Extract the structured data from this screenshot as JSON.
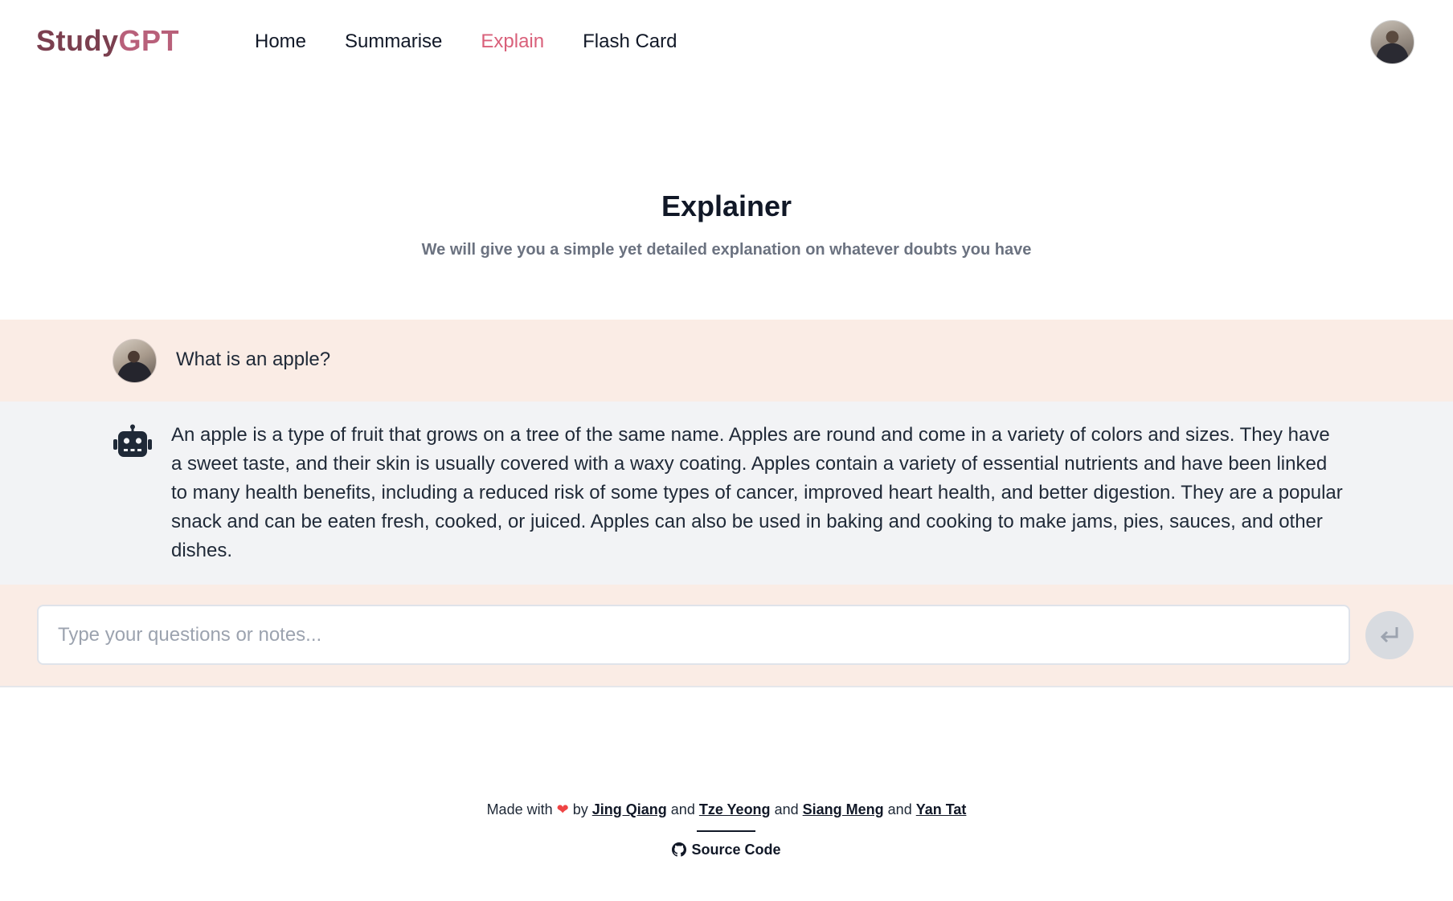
{
  "header": {
    "brand_part1": "Study",
    "brand_part2": "GPT",
    "nav": [
      {
        "label": "Home"
      },
      {
        "label": "Summarise"
      },
      {
        "label": "Explain"
      },
      {
        "label": "Flash Card"
      }
    ],
    "active_nav": "Explain"
  },
  "hero": {
    "title": "Explainer",
    "subtitle": "We will give you a simple yet detailed explanation on whatever doubts you have"
  },
  "chat": {
    "question": "What is an apple?",
    "answer": "An apple is a type of fruit that grows on a tree of the same name. Apples are round and come in a variety of colors and sizes. They have a sweet taste, and their skin is usually covered with a waxy coating. Apples contain a variety of essential nutrients and have been linked to many health benefits, including a reduced risk of some types of cancer, improved heart health, and better digestion. They are a popular snack and can be eaten fresh, cooked, or juiced. Apples can also be used in baking and cooking to make jams, pies, sauces, and other dishes."
  },
  "input": {
    "placeholder": "Type your questions or notes...",
    "value": ""
  },
  "footer": {
    "made_with": "Made with",
    "heart": "❤",
    "by": "by",
    "and": "and",
    "authors": [
      "Jing Qiang",
      "Tze Yeong",
      "Siang Meng",
      "Yan Tat"
    ],
    "source_code": "Source Code"
  },
  "icons": {
    "bot": "robot-icon",
    "send": "enter-return-icon",
    "github": "github-icon"
  },
  "colors": {
    "brand_dark": "#7b3f4f",
    "brand_light": "#b8607a",
    "active_nav": "#d9607a",
    "question_bg": "#faece5",
    "answer_bg": "#f2f3f5",
    "heart": "#ef4444"
  }
}
